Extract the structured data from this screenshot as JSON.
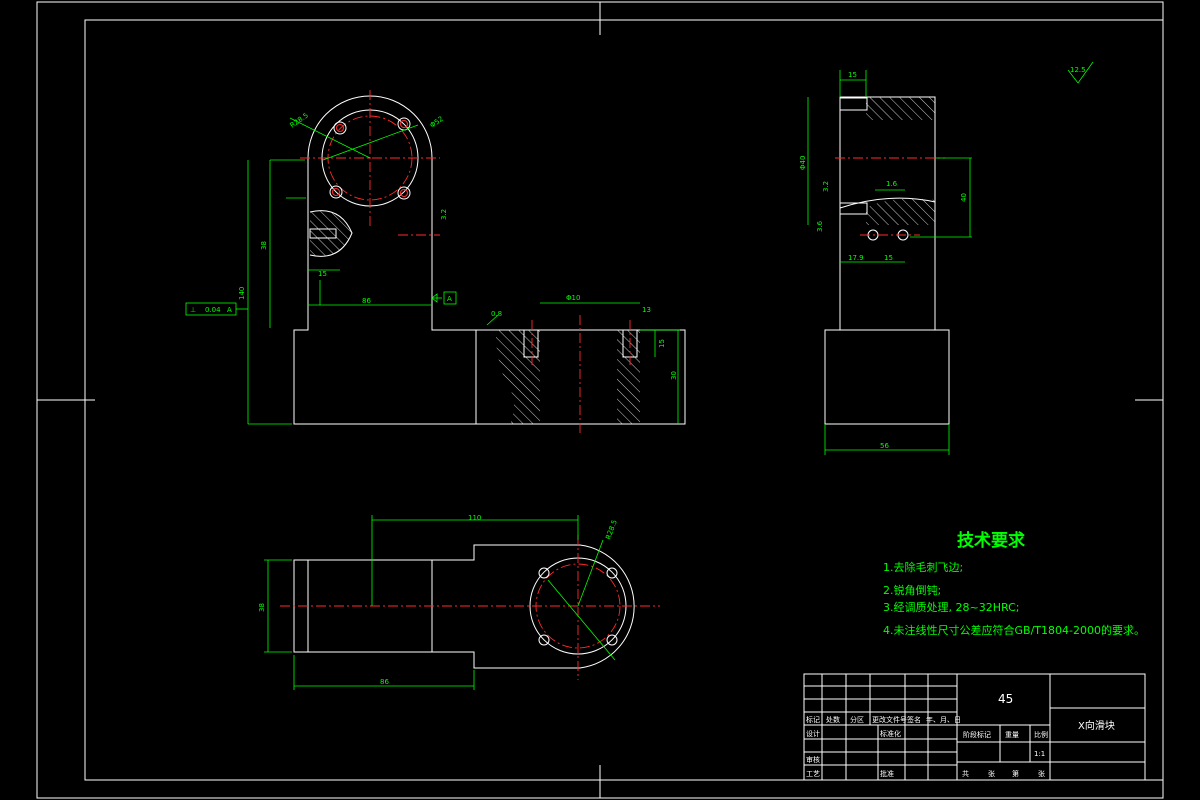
{
  "drawing": {
    "tech_req": {
      "title": "技术要求",
      "items": [
        "1.去除毛刺飞边;",
        "2.锐角倒钝;",
        "3.经调质处理, 28~32HRC;",
        "4.未注线性尺寸公差应符合GB/T1804-2000的要求。"
      ]
    },
    "roughness": "12.5",
    "dims": {
      "front": [
        "R28.5",
        "Φ52",
        "140",
        "38",
        "15",
        "86",
        "3.2",
        "Φ10",
        "13",
        "15",
        "30",
        "0.8"
      ],
      "front_datum": "A",
      "front_tolerance": [
        "⊥",
        "0.04",
        "A"
      ],
      "side": [
        "15",
        "Φ40",
        "1.6",
        "3.2",
        "3.6",
        "40",
        "17.9",
        "15",
        "56"
      ],
      "top": [
        "110",
        "38",
        "86",
        "R28.5"
      ]
    },
    "title_block": {
      "material": "45",
      "part_name": "X向滑块",
      "scale_label": "比例",
      "scale_value": "1:1",
      "mark_label": "阶段标记",
      "weight_label": "重量",
      "header_row": [
        "标记",
        "处数",
        "分区",
        "更改文件号",
        "签名",
        "年、月、日"
      ],
      "design_label": "设计",
      "standard_label": "标准化",
      "review_label": "审核",
      "process_label": "工艺",
      "approve_label": "批准",
      "sheet_row": [
        "共",
        "张",
        "第",
        "张"
      ]
    }
  }
}
